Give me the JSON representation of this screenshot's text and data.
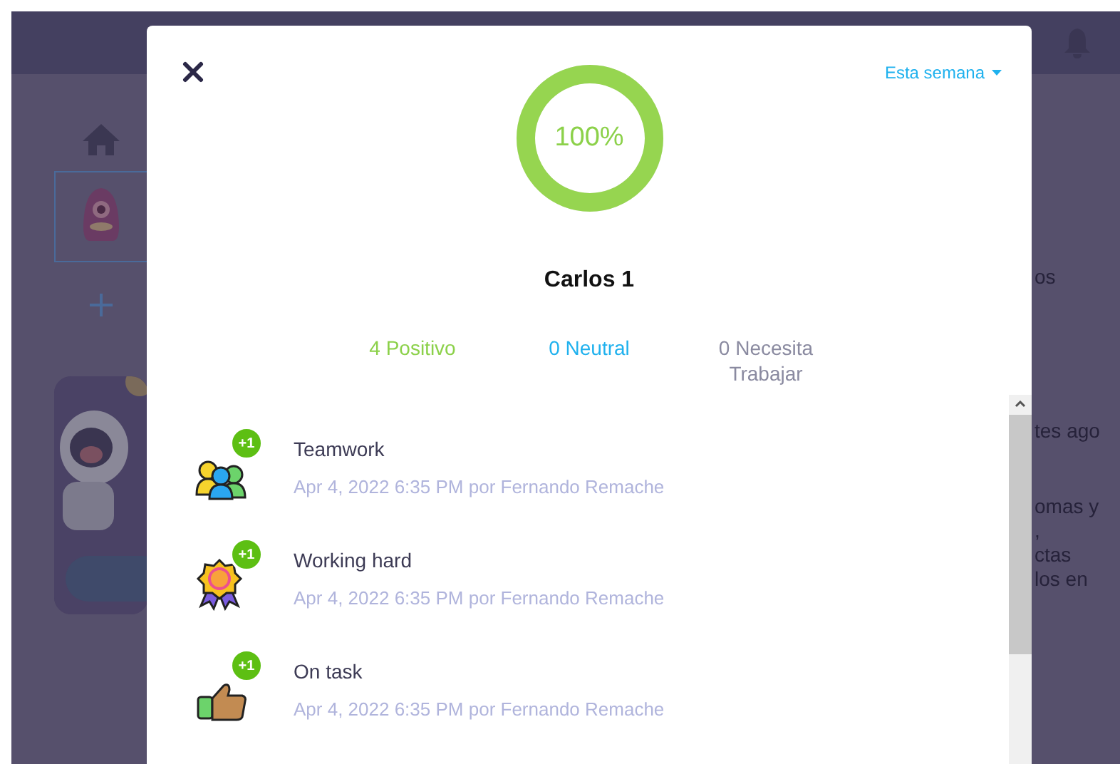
{
  "background": {
    "right_texts": [
      "os",
      "tes ago",
      "omas y",
      ",",
      "ctas",
      "los en"
    ]
  },
  "modal": {
    "period": "Esta semana",
    "score": {
      "label": "100%",
      "level": 1
    },
    "student": "Carlos 1",
    "stats": [
      {
        "label": "4 Positivo",
        "color": "#8cd14a"
      },
      {
        "label": "0 Neutral",
        "color": "#1fb1ee"
      },
      {
        "label": "0 Necesita Trabajar",
        "color": "#8a8aa0"
      }
    ],
    "feedback": [
      {
        "kind": "teamwork",
        "badge": "+1",
        "title": "Teamwork",
        "meta": "Apr 4, 2022 6:35 PM por Fernando Remache"
      },
      {
        "kind": "medal",
        "badge": "+1",
        "title": "Working hard",
        "meta": "Apr 4, 2022 6:35 PM por Fernando Remache"
      },
      {
        "kind": "thumb",
        "badge": "+1",
        "title": "On task",
        "meta": "Apr 4, 2022 6:35 PM por Fernando Remache"
      }
    ]
  }
}
